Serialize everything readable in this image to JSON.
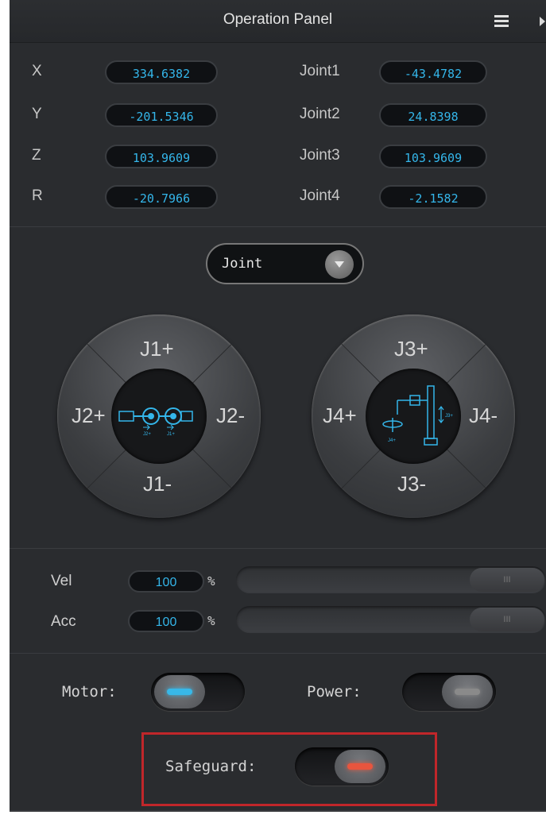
{
  "header": {
    "title": "Operation Panel"
  },
  "coordinates": [
    {
      "label": "X",
      "value": "334.6382"
    },
    {
      "label": "Y",
      "value": "-201.5346"
    },
    {
      "label": "Z",
      "value": "103.9609"
    },
    {
      "label": "R",
      "value": "-20.7966"
    }
  ],
  "joints": [
    {
      "label": "Joint1",
      "value": "-43.4782"
    },
    {
      "label": "Joint2",
      "value": "24.8398"
    },
    {
      "label": "Joint3",
      "value": "103.9609"
    },
    {
      "label": "Joint4",
      "value": "-2.1582"
    }
  ],
  "mode": {
    "selected": "Joint"
  },
  "dial_left": {
    "top": "J1+",
    "bottom": "J1-",
    "left": "J2+",
    "right": "J2-",
    "icon_labels": [
      "J2+",
      "J1+"
    ]
  },
  "dial_right": {
    "top": "J3+",
    "bottom": "J3-",
    "left": "J4+",
    "right": "J4-",
    "icon_labels": [
      "J3+",
      "J4+"
    ]
  },
  "speed": {
    "vel": {
      "label": "Vel",
      "value": "100",
      "unit": "%",
      "level": 1.0
    },
    "acc": {
      "label": "Acc",
      "value": "100",
      "unit": "%",
      "level": 1.0
    }
  },
  "toggles": {
    "motor": {
      "label": "Motor:",
      "state": "on",
      "indicator_color": "#38b8e8"
    },
    "power": {
      "label": "Power:",
      "state": "off",
      "indicator_color": "#8a8a8a"
    },
    "safeguard": {
      "label": "Safeguard:",
      "state": "on",
      "indicator_color": "#e8553e"
    }
  },
  "colors": {
    "accent": "#34b6ea",
    "highlight_border": "#c0262a"
  }
}
